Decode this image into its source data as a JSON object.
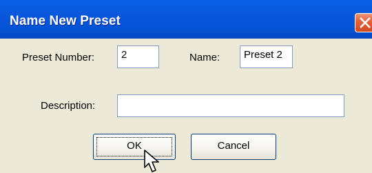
{
  "dialog": {
    "title": "Name New Preset"
  },
  "fields": {
    "preset_number": {
      "label": "Preset Number:",
      "value": "2"
    },
    "name": {
      "label": "Name:",
      "value": "Preset 2"
    },
    "description": {
      "label": "Description:",
      "value": ""
    }
  },
  "buttons": {
    "ok": "OK",
    "cancel": "Cancel"
  },
  "icons": {
    "close": "close-icon",
    "cursor": "mouse-pointer-icon"
  },
  "colors": {
    "titlebar": "#0a5fe8",
    "dialog_background": "#ece9d8",
    "close_button": "#e2633e"
  }
}
